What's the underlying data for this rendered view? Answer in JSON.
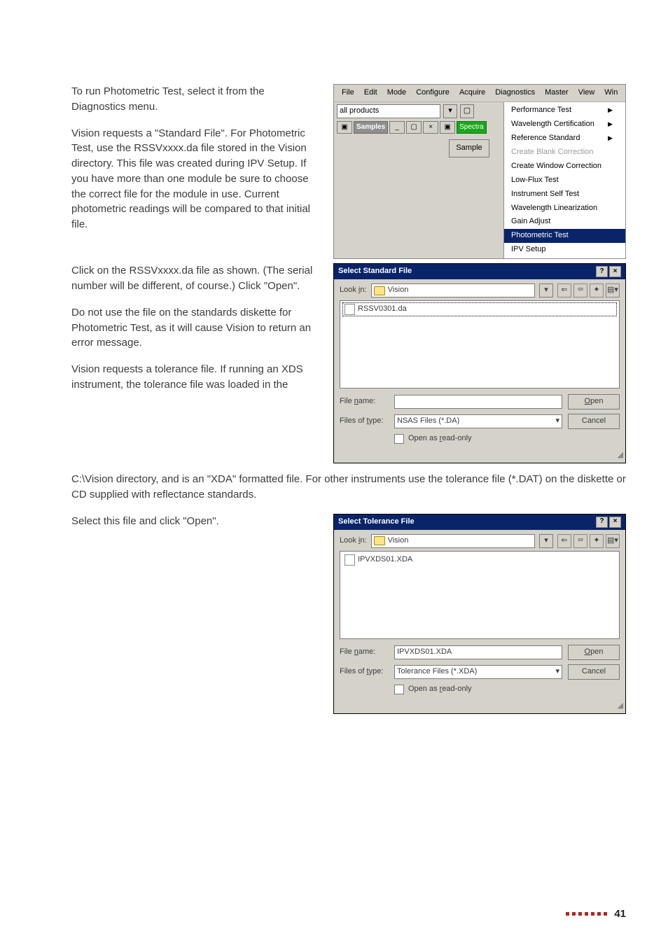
{
  "body": {
    "p1": "To run Photometric Test, select it from the Diagnostics menu.",
    "p2": "Vision requests a \"Standard File\". For Photometric Test, use the RSSVxxxx.da file stored in the Vision directory. This file was created during IPV Setup. If you have more than one module be sure to choose the correct file for the module in use. Current photometric readings will be compared to that initial file.",
    "p3": "Click on the RSSVxxxx.da file as shown. (The serial number will be different, of course.) Click \"Open\".",
    "p4": "Do not use the file on the standards diskette for Photometric Test, as it will cause Vision to return an error message.",
    "p5": "Vision requests a tolerance file. If running an XDS instrument, the tolerance file was loaded in the",
    "p6": "C:\\Vision directory, and is an \"XDA\" formatted file. For other instruments use the tolerance file (*.DAT) on the diskette or CD supplied with reflectance standards.",
    "p7": "Select this file and click \"Open\"."
  },
  "fig1": {
    "menu": [
      "File",
      "Edit",
      "Mode",
      "Configure",
      "Acquire",
      "Diagnostics",
      "Master",
      "View",
      "Win"
    ],
    "combo": "all products",
    "child": {
      "title": "Samples",
      "green": "Spectra"
    },
    "sample_btn": "Sample",
    "diagnostics": [
      {
        "label": "Performance Test",
        "arrow": true
      },
      {
        "label": "Wavelength Certification",
        "arrow": true
      },
      {
        "label": "Reference Standard",
        "arrow": true
      },
      {
        "label": "Create Blank Correction",
        "disabled": true
      },
      {
        "label": "Create Window Correction"
      },
      {
        "label": "Low-Flux Test"
      },
      {
        "label": "Instrument Self Test"
      },
      {
        "label": "Wavelength Linearization"
      },
      {
        "label": "Gain Adjust"
      },
      {
        "label": "Photometric Test",
        "highlight": true
      },
      {
        "label": "IPV Setup"
      }
    ]
  },
  "fig2": {
    "title": "Select Standard File",
    "lookin_label": "Look in:",
    "lookin_value": "Vision",
    "file": "RSSV0301.da",
    "file_selected": true,
    "filename_label": "File name:",
    "filename_value": "",
    "filetype_label": "Files of type:",
    "filetype_value": "NSAS Files (*.DA)",
    "open": "Open",
    "cancel": "Cancel",
    "readonly": "Open as read-only"
  },
  "fig3": {
    "title": "Select Tolerance File",
    "lookin_label": "Look in:",
    "lookin_value": "Vision",
    "file": "IPVXDS01.XDA",
    "file_selected": false,
    "filename_label": "File name:",
    "filename_value": "IPVXDS01.XDA",
    "filetype_label": "Files of type:",
    "filetype_value": "Tolerance Files (*.XDA)",
    "open": "Open",
    "cancel": "Cancel",
    "readonly": "Open as read-only"
  },
  "footer": {
    "page": "41"
  }
}
